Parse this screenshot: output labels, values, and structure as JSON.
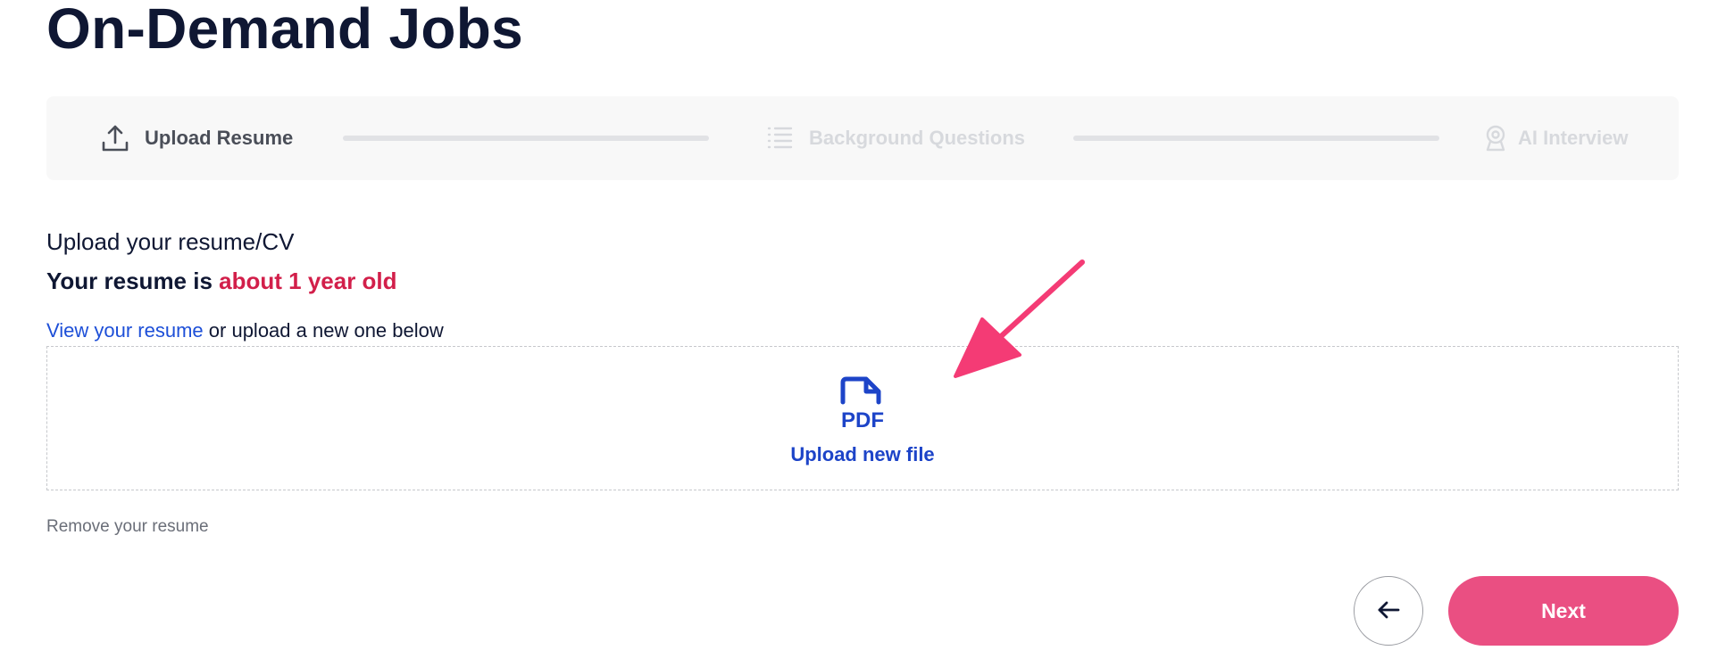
{
  "page": {
    "title": "On-Demand Jobs"
  },
  "stepper": {
    "steps": [
      {
        "label": "Upload Resume",
        "icon": "upload-icon",
        "state": "active"
      },
      {
        "label": "Background Questions",
        "icon": "list-icon",
        "state": "inactive"
      },
      {
        "label": "AI Interview",
        "icon": "webcam-icon",
        "state": "inactive"
      }
    ]
  },
  "resume": {
    "heading": "Upload your resume/CV",
    "age_prefix": "Your resume is ",
    "age_value": "about 1 year old",
    "view_link": "View your resume",
    "view_suffix": " or upload a new one below",
    "upload_label": "Upload new file",
    "pdf_icon_text": "PDF",
    "remove_label": "Remove your resume"
  },
  "actions": {
    "back_icon": "arrow-left-icon",
    "next_label": "Next"
  },
  "colors": {
    "title": "#0f1733",
    "accent_link": "#1d4fd8",
    "upload_blue": "#1d44c8",
    "warning": "#d21f4a",
    "next_button": "#ea4f82",
    "annotation_arrow": "#f43b75"
  }
}
